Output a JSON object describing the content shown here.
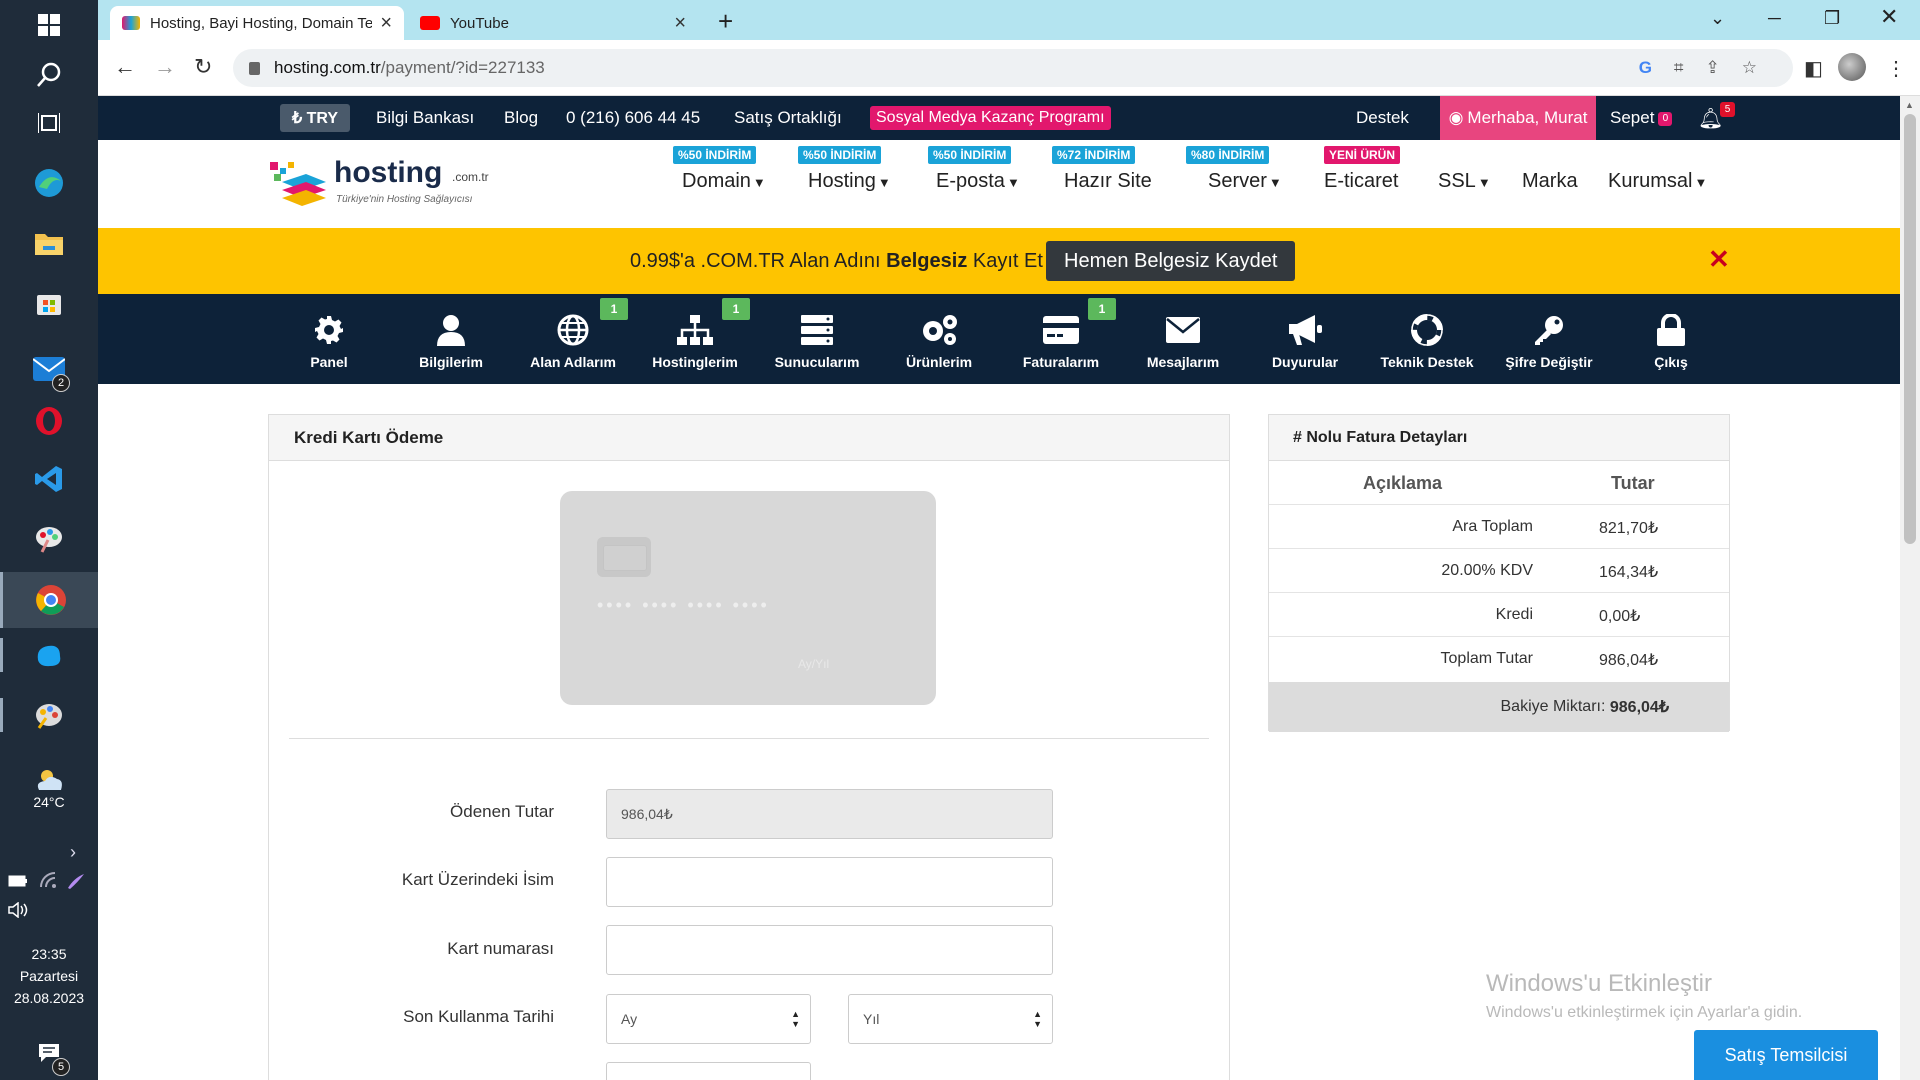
{
  "taskbar": {
    "weather_temp": "24°C",
    "time": "23:35",
    "day": "Pazartesi",
    "date": "28.08.2023",
    "mail_badge": "2",
    "notif_badge": "5"
  },
  "browser": {
    "tabs": [
      {
        "label": "Hosting, Bayi Hosting, Domain Te"
      },
      {
        "label": "YouTube"
      }
    ],
    "url_domain": "hosting.com.tr",
    "url_path": "/payment/?id=227133"
  },
  "topbar": {
    "currency": "₺ TRY",
    "links": [
      "Bilgi Bankası",
      "Blog",
      "0 (216) 606 44 45",
      "Satış Ortaklığı"
    ],
    "social": "Sosyal Medya Kazanç Programı",
    "support": "Destek",
    "hello": "Merhaba, Murat",
    "cart": "Sepet",
    "cart_count": "0",
    "notif_count": "5"
  },
  "logo": {
    "word": "hosting",
    "tld": ".com.tr",
    "slogan": "Türkiye'nin Hosting Sağlayıcısı"
  },
  "menu": [
    {
      "label": "Domain",
      "tag": "%50 İNDİRİM",
      "caret": true
    },
    {
      "label": "Hosting",
      "tag": "%50 İNDİRİM",
      "caret": true
    },
    {
      "label": "E-posta",
      "tag": "%50 İNDİRİM",
      "caret": true
    },
    {
      "label": "Hazır Site",
      "tag": "%72 İNDİRİM",
      "caret": false
    },
    {
      "label": "Server",
      "tag": "%80 İNDİRİM",
      "caret": true
    },
    {
      "label": "E-ticaret",
      "tag": "YENİ ÜRÜN",
      "caret": false
    },
    {
      "label": "SSL",
      "tag": "",
      "caret": true
    },
    {
      "label": "Marka",
      "tag": "",
      "caret": false
    },
    {
      "label": "Kurumsal",
      "tag": "",
      "caret": true
    }
  ],
  "promo": {
    "text_pre": "0.99$'a .COM.TR Alan Adını ",
    "text_bold": "Belgesiz",
    "text_post": " Kayıt Et",
    "button": "Hemen Belgesiz Kaydet",
    "close": "✕"
  },
  "panel_nav": [
    {
      "label": "Panel",
      "icon": "gear-icon",
      "badge": ""
    },
    {
      "label": "Bilgilerim",
      "icon": "user-icon",
      "badge": ""
    },
    {
      "label": "Alan Adlarım",
      "icon": "globe-icon",
      "badge": "1"
    },
    {
      "label": "Hostinglerim",
      "icon": "sitemap-icon",
      "badge": "1"
    },
    {
      "label": "Sunucularım",
      "icon": "server-icon",
      "badge": ""
    },
    {
      "label": "Ürünlerim",
      "icon": "cogs-icon",
      "badge": ""
    },
    {
      "label": "Faturalarım",
      "icon": "credit-card-icon",
      "badge": "1"
    },
    {
      "label": "Mesajlarım",
      "icon": "envelope-icon",
      "badge": ""
    },
    {
      "label": "Duyurular",
      "icon": "bullhorn-icon",
      "badge": ""
    },
    {
      "label": "Teknik Destek",
      "icon": "lifebuoy-icon",
      "badge": ""
    },
    {
      "label": "Şifre Değiştir",
      "icon": "key-icon",
      "badge": ""
    },
    {
      "label": "Çıkış",
      "icon": "lock-icon",
      "badge": ""
    }
  ],
  "payment": {
    "title": "Kredi Kartı Ödeme",
    "card_number_mask": "•••• •••• •••• ••••",
    "card_expiry_hint": "Ay/Yıl",
    "fields": {
      "amount_label": "Ödenen Tutar",
      "amount_value": "986,04₺",
      "name_label": "Kart Üzerindeki İsim",
      "name_value": "",
      "number_label": "Kart numarası",
      "number_value": "",
      "expiry_label": "Son Kullanma Tarihi",
      "month_value": "Ay",
      "year_value": "Yıl"
    }
  },
  "invoice": {
    "title": "# Nolu Fatura Detayları",
    "col_desc": "Açıklama",
    "col_amount": "Tutar",
    "rows": [
      {
        "desc": "Ara Toplam",
        "amount": "821,70₺"
      },
      {
        "desc": "20.00% KDV",
        "amount": "164,34₺"
      },
      {
        "desc": "Kredi",
        "amount": "0,00₺"
      },
      {
        "desc": "Toplam Tutar",
        "amount": "986,04₺"
      }
    ],
    "balance_label": "Bakiye Miktarı:",
    "balance_value": "986,04₺"
  },
  "watermark": {
    "line1": "Windows'u Etkinleştir",
    "line2": "Windows'u etkinleştirmek için Ayarlar'a gidin."
  },
  "sales_button": "Satış Temsilcisi",
  "colors": {
    "navy": "#0d2239",
    "promo_yellow": "#fec400",
    "pink": "#e2176d",
    "discount_blue": "#1aa3d8",
    "badge_green": "#5cb85c"
  }
}
